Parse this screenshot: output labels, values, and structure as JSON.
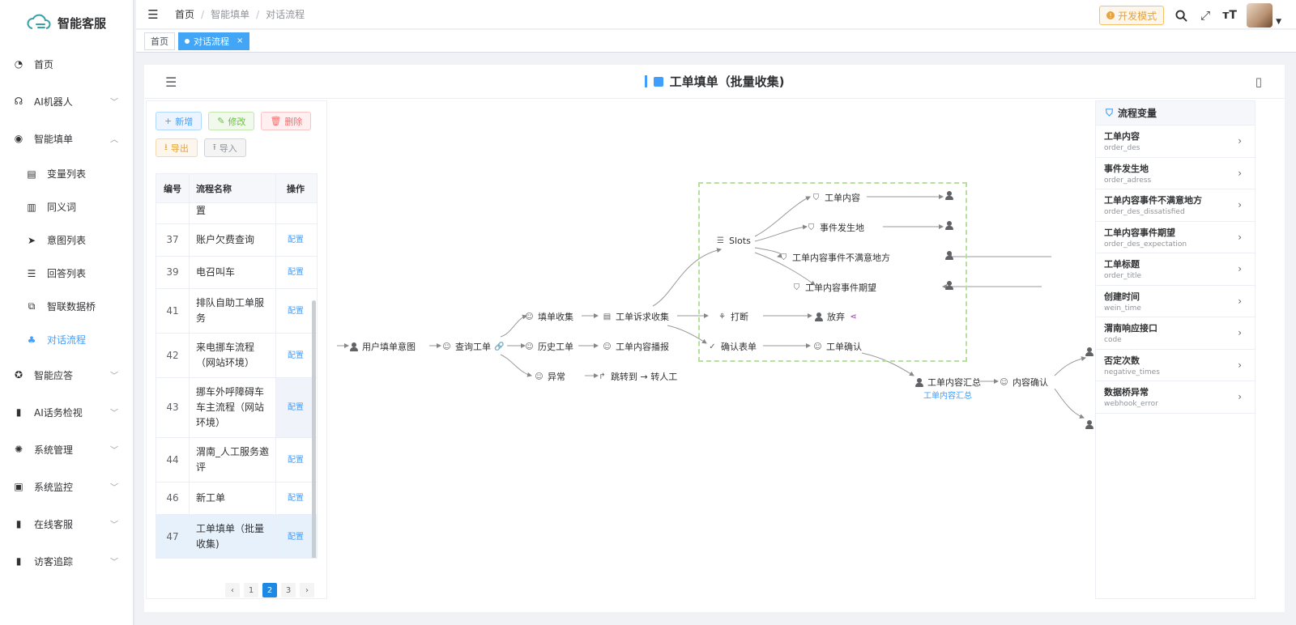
{
  "app": {
    "logo_text": "智能客服"
  },
  "sidebar": {
    "items": [
      {
        "label": "首页",
        "icon": "dashboard-icon",
        "chevron": ""
      },
      {
        "label": "AI机器人",
        "icon": "robot-icon",
        "chevron": "﹀"
      },
      {
        "label": "智能填单",
        "icon": "wechat-icon",
        "chevron": "︿"
      }
    ],
    "sub_items": [
      {
        "label": "变量列表",
        "icon": "table-icon"
      },
      {
        "label": "同义词",
        "icon": "book-icon"
      },
      {
        "label": "意图列表",
        "icon": "send-icon"
      },
      {
        "label": "回答列表",
        "icon": "list-icon"
      },
      {
        "label": "智联数据桥",
        "icon": "link-icon"
      },
      {
        "label": "对话流程",
        "icon": "tree-icon"
      }
    ],
    "items_after": [
      {
        "label": "智能应答",
        "icon": "gear-icon",
        "chevron": "﹀"
      },
      {
        "label": "AI话务检视",
        "icon": "bar-chart-icon",
        "chevron": "﹀"
      },
      {
        "label": "系统管理",
        "icon": "settings-icon",
        "chevron": "﹀"
      },
      {
        "label": "系统监控",
        "icon": "monitor-icon",
        "chevron": "﹀"
      },
      {
        "label": "在线客服",
        "icon": "bar-chart-icon",
        "chevron": "﹀"
      },
      {
        "label": "访客追踪",
        "icon": "bar-chart-icon",
        "chevron": "﹀"
      }
    ]
  },
  "topbar": {
    "breadcrumbs": [
      "首页",
      "智能填单",
      "对话流程"
    ],
    "dev_mode": "开发模式"
  },
  "tabs": {
    "home": "首页",
    "active": "对话流程",
    "close": "×"
  },
  "panel": {
    "title": "工单填单（批量收集)"
  },
  "toolbar": {
    "add": "新增",
    "edit": "修改",
    "delete": "删除",
    "export": "导出",
    "import": "导入"
  },
  "table": {
    "headers": {
      "id": "编号",
      "name": "流程名称",
      "op": "操作"
    },
    "partial_row": {
      "name": "置"
    },
    "rows": [
      {
        "id": "37",
        "name": "账户欠费查询",
        "op": "配置"
      },
      {
        "id": "39",
        "name": "电召叫车",
        "op": "配置"
      },
      {
        "id": "41",
        "name": "排队自助工单服务",
        "op": "配置"
      },
      {
        "id": "42",
        "name": "来电挪车流程（网站环境）",
        "op": "配置"
      },
      {
        "id": "43",
        "name": "挪车外呼障碍车车主流程（网站环境）",
        "op": "配置"
      },
      {
        "id": "44",
        "name": "渭南_人工服务邀评",
        "op": "配置"
      },
      {
        "id": "46",
        "name": "新工单",
        "op": "配置"
      },
      {
        "id": "47",
        "name": "工单填单（批量收集)",
        "op": "配置"
      }
    ]
  },
  "pagination": {
    "prev": "‹",
    "pages": [
      "1",
      "2",
      "3"
    ],
    "current": "2",
    "next": "›"
  },
  "flow": {
    "nodes": {
      "user_intent": "用户填单意图",
      "query_ticket": "查询工单",
      "fill_collect": "填单收集",
      "history_ticket": "历史工单",
      "exception": "异常",
      "ticket_appeal": "工单诉求收集",
      "ticket_broadcast": "工单内容播报",
      "transfer": "跳转到 → 转人工",
      "slots": "Slots",
      "slot1": "工单内容",
      "slot2": "事件发生地",
      "slot3": "工单内容事件不满意地方",
      "slot4": "工单内容事件期望",
      "interrupt": "打断",
      "give_up": "放弃",
      "confirm_form": "确认表单",
      "ticket_confirm": "工单确认",
      "ticket_summary": "工单内容汇总",
      "ticket_summary_sub": "工单内容汇总",
      "content_confirm": "内容确认"
    }
  },
  "variables": {
    "title": "流程变量",
    "items": [
      {
        "name": "工单内容",
        "code": "order_des"
      },
      {
        "name": "事件发生地",
        "code": "order_adress"
      },
      {
        "name": "工单内容事件不满意地方",
        "code": "order_des_dissatisfied"
      },
      {
        "name": "工单内容事件期望",
        "code": "order_des_expectation"
      },
      {
        "name": "工单标题",
        "code": "order_title"
      },
      {
        "name": "创建时间",
        "code": "wein_time"
      },
      {
        "name": "渭南响应接口",
        "code": "code"
      },
      {
        "name": "否定次数",
        "code": "negative_times"
      },
      {
        "name": "数据桥异常",
        "code": "webhook_error"
      }
    ]
  },
  "colors": {
    "accent": "#409eff",
    "dash_border": "#b5e09e",
    "active_tab": "#42a5f5",
    "dev_badge": "#e6a23c"
  }
}
